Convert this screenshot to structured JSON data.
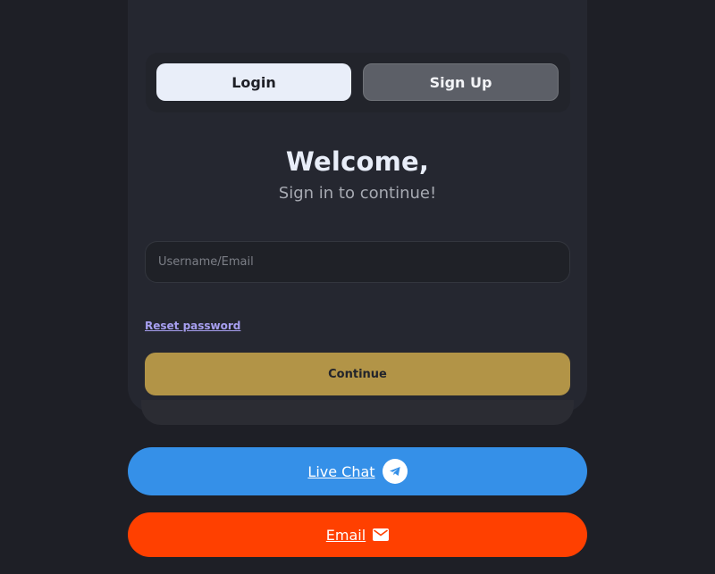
{
  "tabs": {
    "login": "Login",
    "signup": "Sign Up"
  },
  "heading": {
    "title": "Welcome,",
    "subtitle": "Sign in to continue!"
  },
  "form": {
    "username_placeholder": "Username/Email",
    "username_value": "",
    "reset_link": "Reset password",
    "continue_label": "Continue"
  },
  "support": {
    "live_chat_label": "Live Chat",
    "live_chat_icon": "telegram-icon",
    "email_label": "Email",
    "email_icon": "mail-icon"
  },
  "colors": {
    "background": "#1e1f26",
    "card": "#252730",
    "active_tab": "#e9eef9",
    "continue": "#b29447",
    "live_chat": "#3590e8",
    "email": "#ff4000",
    "link": "#a79ff0"
  }
}
